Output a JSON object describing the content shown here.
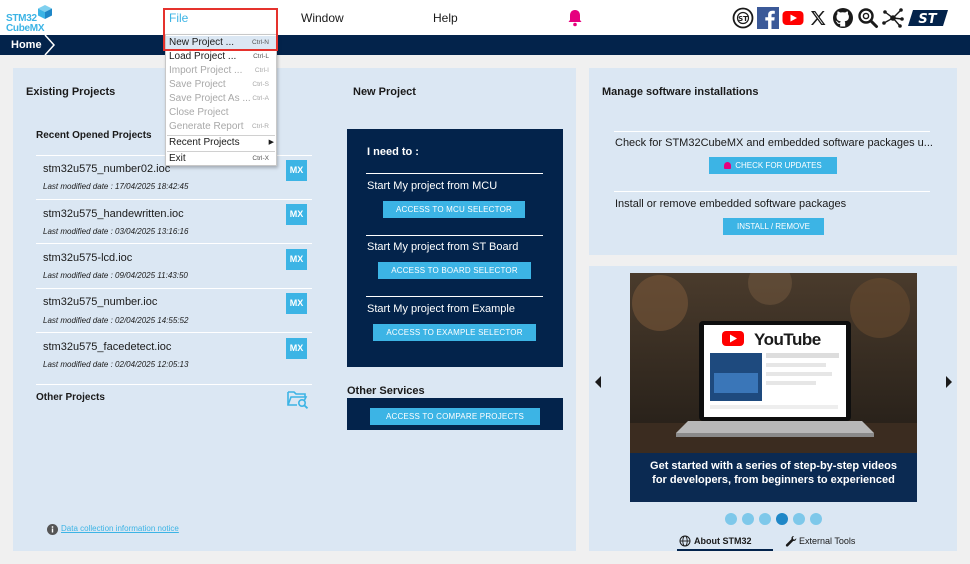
{
  "app": {
    "logo_line1": "STM32",
    "logo_line2": "CubeMX"
  },
  "menubar": {
    "file": "File",
    "window": "Window",
    "help": "Help"
  },
  "breadcrumb": {
    "home": "Home"
  },
  "social_icons": [
    "st-community-icon",
    "facebook-icon",
    "youtube-icon",
    "x-icon",
    "github-icon",
    "search-icon",
    "network-icon",
    "st-logo"
  ],
  "file_menu": {
    "items": [
      {
        "label": "New Project ...",
        "shortcut": "Ctrl-N",
        "enabled": true
      },
      {
        "label": "Load Project ...",
        "shortcut": "Ctrl-L",
        "enabled": true
      },
      {
        "label": "Import Project ...",
        "shortcut": "Ctrl-I",
        "enabled": false
      },
      {
        "label": "Save Project",
        "shortcut": "Ctrl-S",
        "enabled": false
      },
      {
        "label": "Save Project As ...",
        "shortcut": "Ctrl-A",
        "enabled": false
      },
      {
        "label": "Close Project",
        "shortcut": "",
        "enabled": false
      },
      {
        "label": "Generate Report",
        "shortcut": "Ctrl-R",
        "enabled": false
      },
      {
        "label": "Recent Projects",
        "shortcut": "",
        "enabled": true
      },
      {
        "label": "Exit",
        "shortcut": "Ctrl-X",
        "enabled": true
      }
    ]
  },
  "existing_projects": {
    "title": "Existing Projects",
    "recent_title": "Recent Opened Projects",
    "items": [
      {
        "name": "stm32u575_number02.ioc",
        "date": "Last modified date : 17/04/2025 18:42:45"
      },
      {
        "name": "stm32u575_handewritten.ioc",
        "date": "Last modified date : 03/04/2025 13:16:16"
      },
      {
        "name": "stm32u575-lcd.ioc",
        "date": "Last modified date : 09/04/2025 11:43:50"
      },
      {
        "name": "stm32u575_number.ioc",
        "date": "Last modified date : 02/04/2025 14:55:52"
      },
      {
        "name": "stm32u575_facedetect.ioc",
        "date": "Last modified date : 02/04/2025 12:05:13"
      }
    ],
    "mx_label": "MX",
    "other_title": "Other Projects"
  },
  "new_project": {
    "title": "New Project",
    "need_to": "I need to :",
    "options": [
      {
        "label": "Start My project from MCU",
        "button": "ACCESS TO MCU SELECTOR"
      },
      {
        "label": "Start My project from ST Board",
        "button": "ACCESS TO BOARD SELECTOR"
      },
      {
        "label": "Start My project from Example",
        "button": "ACCESS TO EXAMPLE SELECTOR"
      }
    ]
  },
  "other_services": {
    "title": "Other Services",
    "button": "ACCESS TO COMPARE PROJECTS"
  },
  "manage": {
    "title": "Manage software installations",
    "check_text": "Check for STM32CubeMX and embedded software packages u...",
    "check_button": "CHECK FOR UPDATES",
    "install_text": "Install or remove embedded software packages",
    "install_button": "INSTALL / REMOVE"
  },
  "carousel": {
    "youtube_label": "YouTube",
    "caption_line1": "Get started with a series of step-by-step videos",
    "caption_line2": "for developers, from beginners to experienced",
    "dots": 6,
    "active_dot": 4,
    "tabs": {
      "about": "About STM32",
      "external": "External Tools"
    }
  },
  "footer": {
    "notice": "Data collection information notice"
  },
  "colors": {
    "accent": "#3cb4e5",
    "navy": "#03234b",
    "panel": "#dbe7f3",
    "highlight": "#e5322d"
  }
}
